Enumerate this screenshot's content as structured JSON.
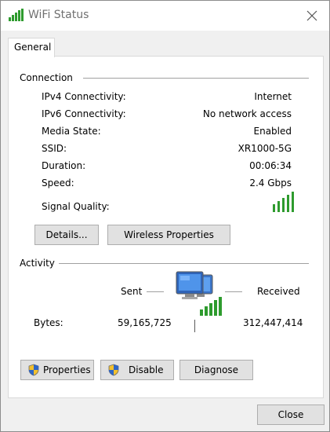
{
  "window": {
    "title": "WiFi Status",
    "icon": "wifi-signal-icon"
  },
  "tabs": [
    {
      "label": "General"
    }
  ],
  "connection": {
    "heading": "Connection",
    "rows": [
      {
        "label": "IPv4 Connectivity:",
        "value": "Internet"
      },
      {
        "label": "IPv6 Connectivity:",
        "value": "No network access"
      },
      {
        "label": "Media State:",
        "value": "Enabled"
      },
      {
        "label": "SSID:",
        "value": "XR1000-5G"
      },
      {
        "label": "Duration:",
        "value": "00:06:34"
      },
      {
        "label": "Speed:",
        "value": "2.4 Gbps"
      }
    ],
    "signal_quality_label": "Signal Quality:",
    "signal_bars_lit": 5,
    "signal_bars_total": 5,
    "details_button": "Details...",
    "wireless_properties_button": "Wireless Properties"
  },
  "activity": {
    "heading": "Activity",
    "sent_label": "Sent",
    "received_label": "Received",
    "bytes_label": "Bytes:",
    "bytes_sent": "59,165,725",
    "bytes_received": "312,447,414",
    "properties_button": "Properties",
    "disable_button": "Disable",
    "diagnose_button": "Diagnose"
  },
  "footer": {
    "close_button": "Close"
  },
  "colors": {
    "signal_green": "#2e9b2e",
    "button_face": "#e1e1e1",
    "dialog_bg": "#f0f0f0"
  }
}
